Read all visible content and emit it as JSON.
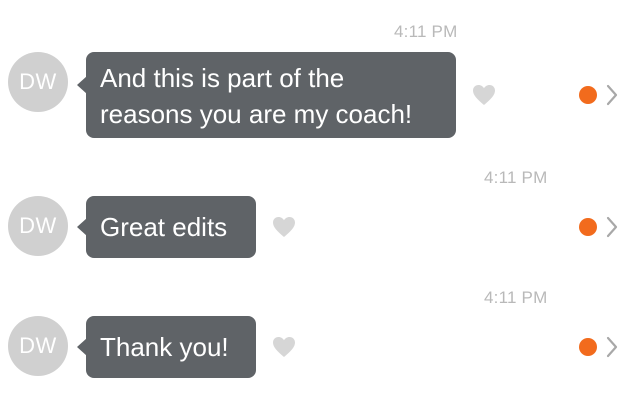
{
  "messages": [
    {
      "time": "4:11 PM",
      "avatar_initials": "DW",
      "text_lines": [
        "And this is part of the",
        "reasons you are my coach!"
      ]
    },
    {
      "time": "4:11 PM",
      "avatar_initials": "DW",
      "text_lines": [
        "Great edits"
      ]
    },
    {
      "time": "4:11 PM",
      "avatar_initials": "DW",
      "text_lines": [
        "Thank you!"
      ]
    }
  ],
  "icons": {
    "like": "heart-icon",
    "status": "status-dot-icon",
    "open": "chevron-right-icon"
  },
  "colors": {
    "bubble": "#5f6367",
    "avatar": "#d0d0d0",
    "timestamp": "#b9b9b9",
    "heart": "#d6d6d6",
    "status_dot": "#f26b1d",
    "chevron": "#a8a8a8"
  }
}
